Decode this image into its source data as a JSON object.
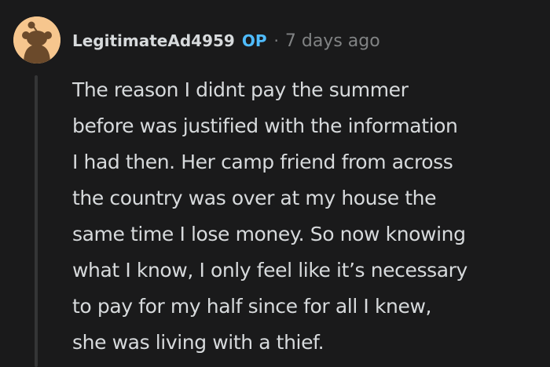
{
  "comment": {
    "username": "LegitimateAd4959",
    "op_badge": "OP",
    "separator": "·",
    "timestamp": "7 days ago",
    "avatar_icon": "snoo-avatar-icon",
    "body_lines": [
      "The reason I didnt pay the summer",
      "before was justified with the information",
      "I had then. Her camp friend from across",
      "the country was over at my house the",
      "same time I lose money. So now knowing",
      "what I know, I only feel like it’s necessary",
      "to pay for my half since for all I knew,",
      "she was living with a thief."
    ]
  },
  "colors": {
    "background": "#1a1a1b",
    "text": "#d7dadc",
    "muted": "#818384",
    "op_badge": "#4fbcff",
    "avatar_bg": "#f6c68e",
    "thread_line": "#343536"
  }
}
